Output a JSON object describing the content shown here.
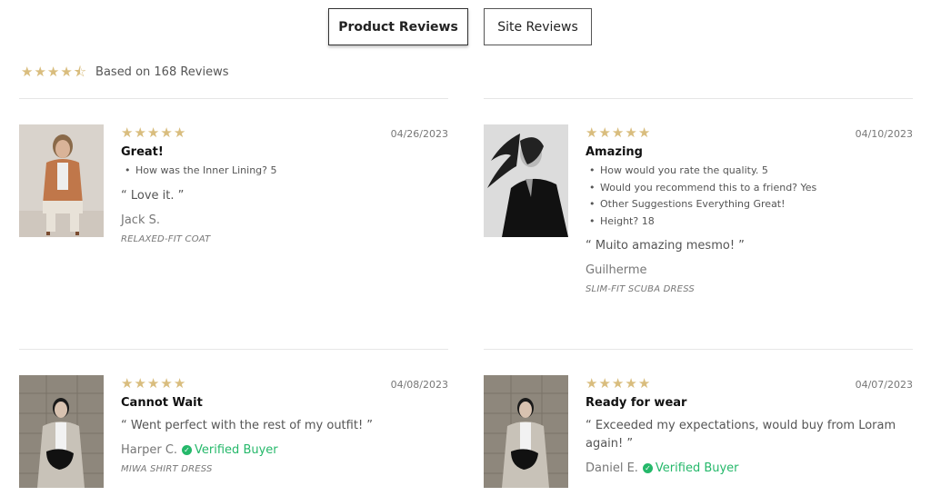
{
  "tabs": {
    "product_reviews": "Product Reviews",
    "site_reviews": "Site Reviews"
  },
  "summary": {
    "rating": 4.5,
    "text": "Based on 168 Reviews"
  },
  "colors": {
    "star": "#d9bd7e",
    "verified": "#25b86a"
  },
  "reviews": [
    {
      "rating": 5,
      "date": "04/26/2023",
      "title": "Great!",
      "qa": [
        "How was the Inner Lining? 5"
      ],
      "quote": "“ Love it. ”",
      "author": "Jack S.",
      "verified": "",
      "product": "RELAXED-FIT COAT"
    },
    {
      "rating": 5,
      "date": "04/10/2023",
      "title": "Amazing",
      "qa": [
        "How would you rate the quality. 5",
        "Would you recommend this to a friend? Yes",
        "Other Suggestions Everything Great!",
        "Height? 18"
      ],
      "quote": "“ Muito amazing mesmo! ”",
      "author": "Guilherme",
      "verified": "",
      "product": "SLIM-FIT SCUBA DRESS"
    },
    {
      "rating": 5,
      "date": "04/08/2023",
      "title": "Cannot Wait",
      "qa": [],
      "quote": "“ Went perfect with the rest of my outfit! ”",
      "author": "Harper C.",
      "verified": "Verified Buyer",
      "product": "MIWA SHIRT DRESS"
    },
    {
      "rating": 5,
      "date": "04/07/2023",
      "title": "Ready for wear",
      "qa": [],
      "quote": "“ Exceeded my expectations, would buy from Loram again! ”",
      "author": "Daniel E.",
      "verified": "Verified Buyer",
      "product": ""
    }
  ]
}
